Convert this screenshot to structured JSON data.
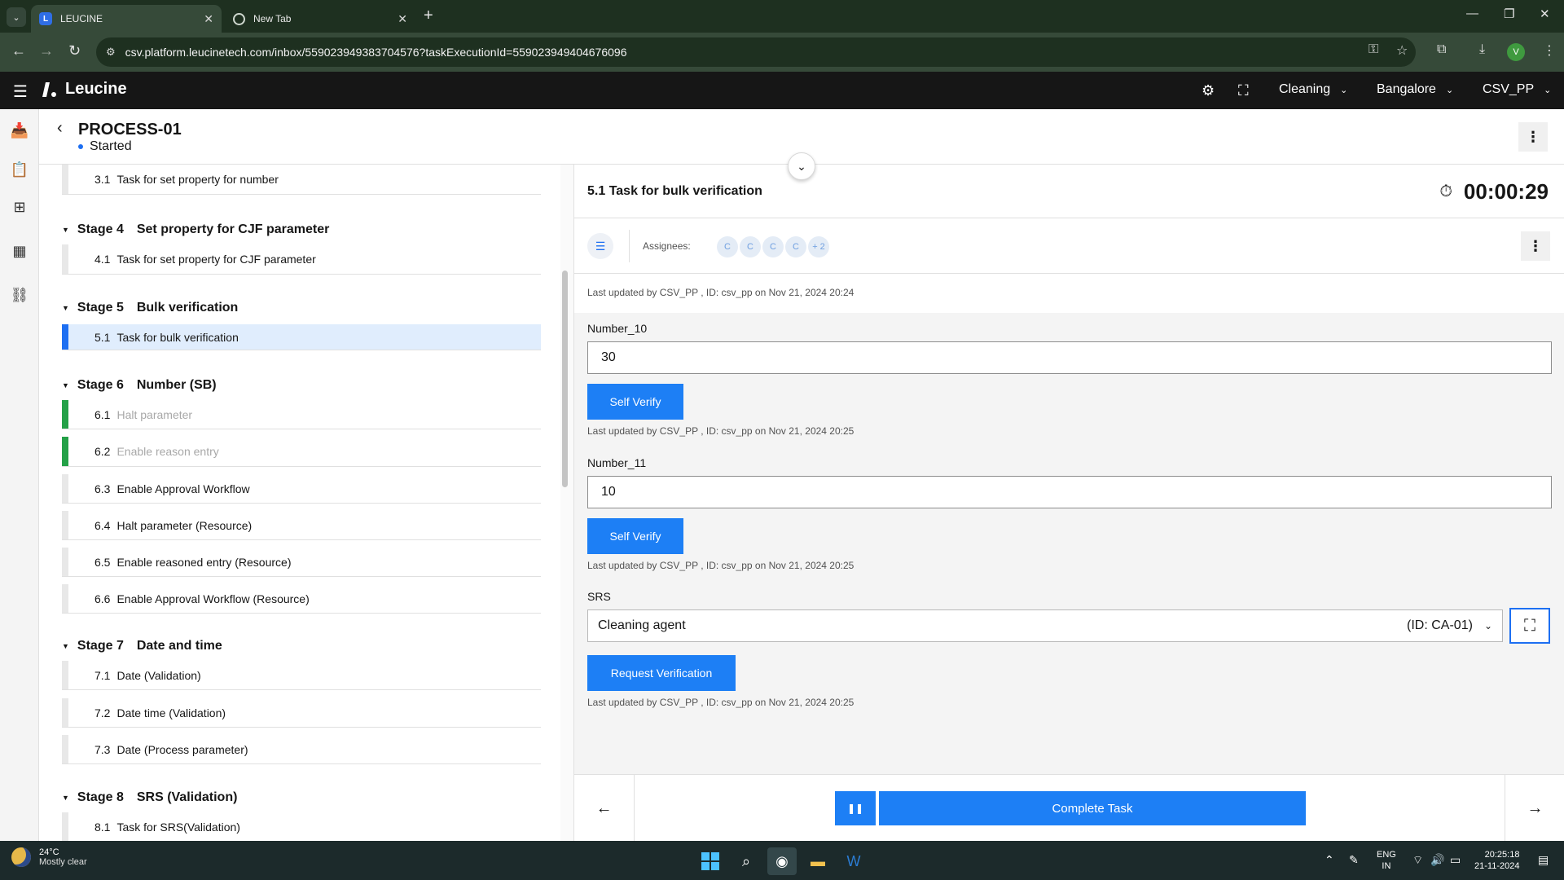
{
  "browser": {
    "tabs": [
      {
        "title": "LEUCINE",
        "active": true
      },
      {
        "title": "New Tab",
        "active": false
      }
    ],
    "url": "csv.platform.leucinetech.com/inbox/559023949383704576?taskExecutionId=559023949404676096",
    "profile_initial": "V"
  },
  "app": {
    "brand": "Leucine",
    "header_dropdowns": [
      "Cleaning",
      "Bangalore",
      "CSV_PP"
    ]
  },
  "process": {
    "title": "PROCESS-01",
    "status": "Started"
  },
  "task_list": {
    "items": [
      {
        "kind": "task",
        "num": "3.1",
        "label": "Task for set property for number",
        "state": "normal"
      },
      {
        "kind": "stage",
        "num": "Stage 4",
        "label": "Set property for CJF parameter"
      },
      {
        "kind": "task",
        "num": "4.1",
        "label": "Task for set property for CJF parameter",
        "state": "normal"
      },
      {
        "kind": "stage",
        "num": "Stage 5",
        "label": "Bulk verification"
      },
      {
        "kind": "task",
        "num": "5.1",
        "label": "Task for bulk verification",
        "state": "selected"
      },
      {
        "kind": "stage",
        "num": "Stage 6",
        "label": "Number (SB)"
      },
      {
        "kind": "task",
        "num": "6.1",
        "label": "Halt parameter",
        "state": "done"
      },
      {
        "kind": "task",
        "num": "6.2",
        "label": "Enable reason entry",
        "state": "done"
      },
      {
        "kind": "task",
        "num": "6.3",
        "label": "Enable Approval Workflow",
        "state": "normal"
      },
      {
        "kind": "task",
        "num": "6.4",
        "label": "Halt parameter (Resource)",
        "state": "normal"
      },
      {
        "kind": "task",
        "num": "6.5",
        "label": "Enable reasoned entry (Resource)",
        "state": "normal"
      },
      {
        "kind": "task",
        "num": "6.6",
        "label": "Enable Approval Workflow (Resource)",
        "state": "normal"
      },
      {
        "kind": "stage",
        "num": "Stage 7",
        "label": "Date and time"
      },
      {
        "kind": "task",
        "num": "7.1",
        "label": "Date (Validation)",
        "state": "normal"
      },
      {
        "kind": "task",
        "num": "7.2",
        "label": "Date time (Validation)",
        "state": "normal"
      },
      {
        "kind": "task",
        "num": "7.3",
        "label": "Date (Process parameter)",
        "state": "normal"
      },
      {
        "kind": "stage",
        "num": "Stage 8",
        "label": "SRS (Validation)"
      },
      {
        "kind": "task",
        "num": "8.1",
        "label": "Task for SRS(Validation)",
        "state": "normal"
      }
    ]
  },
  "task": {
    "title": "5.1 Task for bulk verification",
    "timer": "00:00:29",
    "assignees_label": "Assignees:",
    "assignees": [
      "C",
      "C",
      "C",
      "C",
      "+ 2"
    ],
    "last_updated": "Last updated by CSV_PP , ID: csv_pp on Nov 21, 2024 20:24",
    "fields": {
      "number_10": {
        "label": "Number_10",
        "value": "30",
        "button": "Self Verify",
        "updated": "Last updated by CSV_PP , ID: csv_pp on Nov 21, 2024 20:25"
      },
      "number_11": {
        "label": "Number_11",
        "value": "10",
        "button": "Self Verify",
        "updated": "Last updated by CSV_PP , ID: csv_pp on Nov 21, 2024 20:25"
      },
      "srs": {
        "label": "SRS",
        "value": "Cleaning agent",
        "id": "(ID: CA-01)",
        "button": "Request Verification",
        "updated": "Last updated by CSV_PP , ID: csv_pp on Nov 21, 2024 20:25"
      }
    },
    "complete_button": "Complete Task"
  },
  "taskbar": {
    "temperature": "24°C",
    "weather": "Mostly clear",
    "lang_top": "ENG",
    "lang_bottom": "IN",
    "time": "20:25:18",
    "date": "21-11-2024"
  },
  "colors": {
    "accent": "#1d7ff5",
    "done": "#24a148",
    "selected_bg": "#e0edfd",
    "header_bg": "#161616",
    "browser_bg": "#1e3020"
  }
}
